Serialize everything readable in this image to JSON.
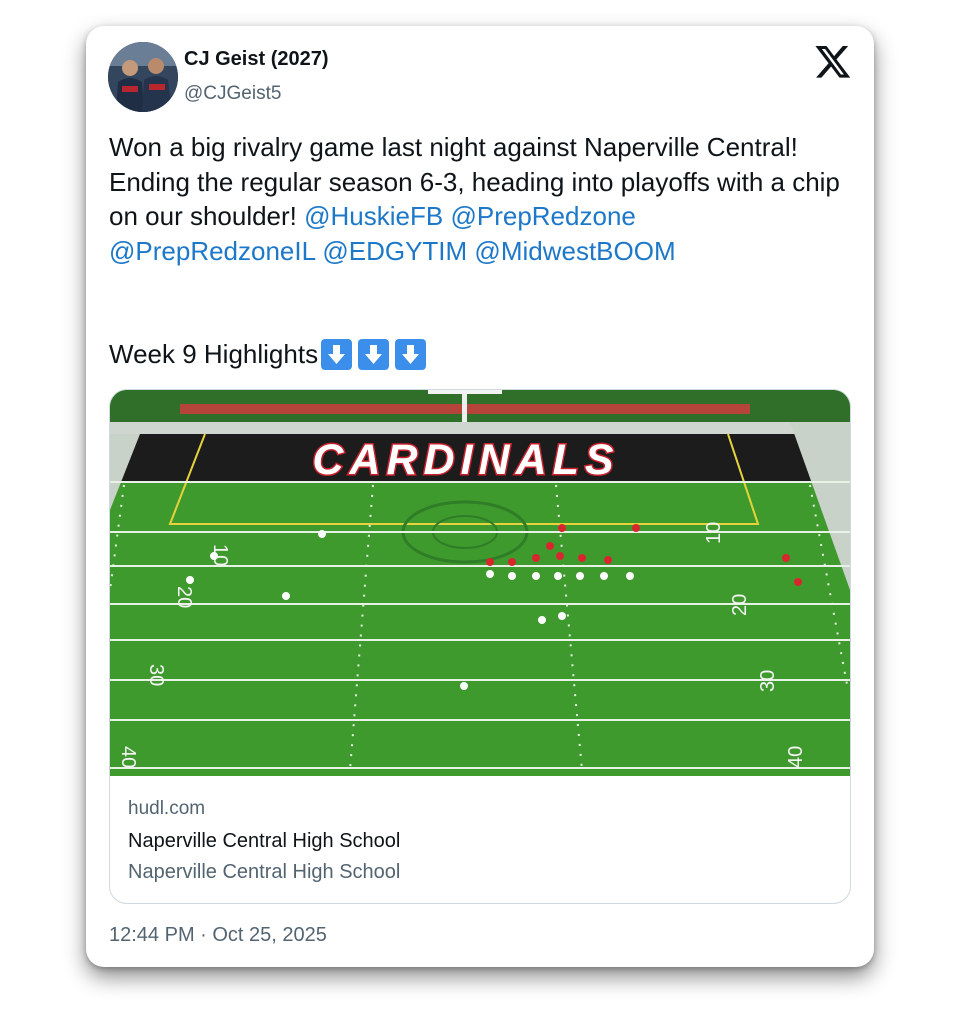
{
  "author": {
    "name": "CJ Geist (2027)",
    "handle": "@CJGeist5",
    "avatar_icon": "profile-photo"
  },
  "brand_icon": "x-logo-icon",
  "tweet": {
    "text_plain": "Won a big rivalry game last night against Naperville Central! Ending the regular season 6-3, heading into playoffs with a chip on our shoulder! ",
    "mentions": [
      "@HuskieFB",
      "@PrepRedzone",
      "@PrepRedzoneIL",
      "@EDGYTIM",
      "@MidwestBOOM"
    ],
    "week_line": "Week 9 Highlights",
    "emoji": [
      "down-arrow-emoji",
      "down-arrow-emoji",
      "down-arrow-emoji"
    ]
  },
  "link_card": {
    "image_text": "CARDINALS",
    "yard_numbers": [
      "10",
      "20",
      "30",
      "40"
    ],
    "domain": "hudl.com",
    "title": "Naperville Central High School",
    "description": "Naperville Central High School"
  },
  "timestamp": "12:44 PM · Oct 25, 2025",
  "colors": {
    "mention": "#1d78c9",
    "secondary_text": "#536471",
    "field_green": "#3f9a2e",
    "endzone": "#1c1c1c",
    "cardinals_red": "#c8202c",
    "emoji_blue": "#3b8eea"
  }
}
